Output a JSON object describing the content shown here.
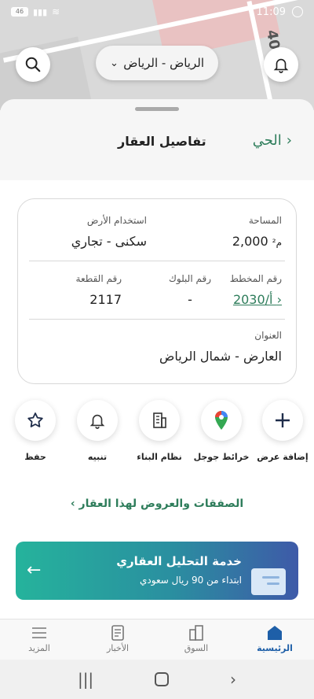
{
  "status_bar": {
    "time": "11:09",
    "battery": "46"
  },
  "map": {
    "label": "40"
  },
  "city_selector": {
    "value": "الرياض - الرياض"
  },
  "header": {
    "title": "تفاصيل العقار",
    "back_label": "الحي"
  },
  "details": {
    "area_label": "المساحة",
    "area_value": "2,000",
    "area_unit": "م²",
    "land_use_label": "استخدام الأرض",
    "land_use_value": "سكنى - تجاري",
    "plan_label": "رقم المخطط",
    "plan_value": "2030/أ",
    "block_label": "رقم البلوك",
    "block_value": "-",
    "plot_label": "رقم القطعة",
    "plot_value": "2117",
    "address_label": "العنوان",
    "address_value": "العارض - شمال الرياض"
  },
  "actions": [
    {
      "label": "إضافة عرض",
      "icon": "plus-icon"
    },
    {
      "label": "خرائط جوجل",
      "icon": "google-maps-pin-icon"
    },
    {
      "label": "نظام البناء",
      "icon": "building-icon"
    },
    {
      "label": "تنبيه",
      "icon": "bell-icon"
    },
    {
      "label": "حفظ",
      "icon": "star-icon"
    }
  ],
  "deals_link": "الصفقات والعروض لهذا العقار",
  "banner": {
    "title": "خدمة التحليل العقاري",
    "subtitle": "ابتداء من 90 ريال سعودي"
  },
  "bottom_nav": [
    {
      "label": "الرئيسية",
      "icon": "home-icon",
      "active": true
    },
    {
      "label": "السوق",
      "icon": "market-icon"
    },
    {
      "label": "الأخبار",
      "icon": "news-icon"
    },
    {
      "label": "المزيد",
      "icon": "menu-icon"
    }
  ],
  "colors": {
    "accent_green": "#2e7d5b",
    "active_blue": "#1e5fa8"
  }
}
